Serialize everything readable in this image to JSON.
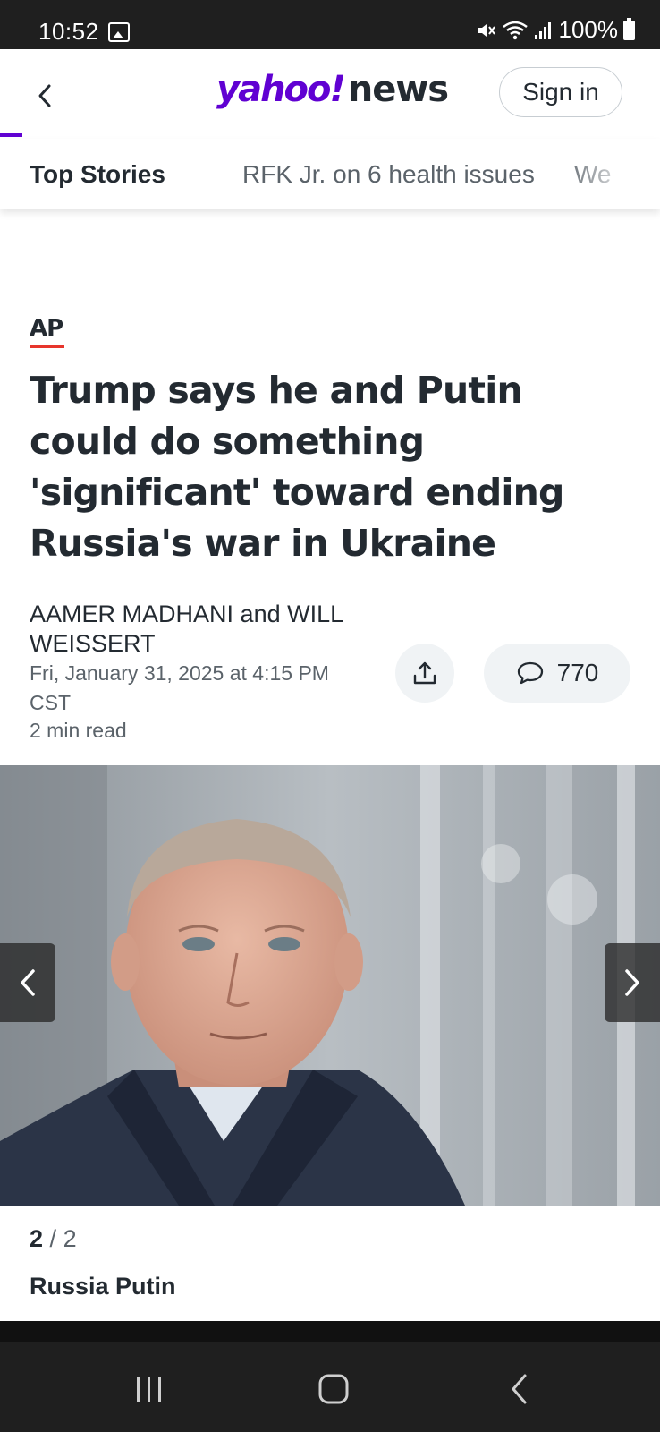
{
  "status_bar": {
    "time": "10:52",
    "battery": "100%",
    "icons": [
      "image-icon",
      "mute-icon",
      "wifi-icon",
      "signal-icon",
      "battery-icon"
    ]
  },
  "header": {
    "logo_yahoo": "yahoo!",
    "logo_news": "news",
    "signin_label": "Sign in",
    "brand_color": "#6001d2"
  },
  "tabs": [
    {
      "label": "Top Stories",
      "active": true
    },
    {
      "label": "RFK Jr. on 6 health issues",
      "active": false
    },
    {
      "label": "We",
      "active": false
    }
  ],
  "article": {
    "source": "AP",
    "headline": "Trump says he and Putin could do something 'significant' toward ending Russia's war in Ukraine",
    "author1": "AAMER MADHANI",
    "and": "and",
    "author2": "WILL WEISSERT",
    "date": "Fri, January 31, 2025 at 4:15 PM CST",
    "read_time": "2 min read",
    "comment_count": "770"
  },
  "gallery": {
    "current": "2",
    "separator": "/",
    "total": "2",
    "caption": "Russia Putin"
  }
}
